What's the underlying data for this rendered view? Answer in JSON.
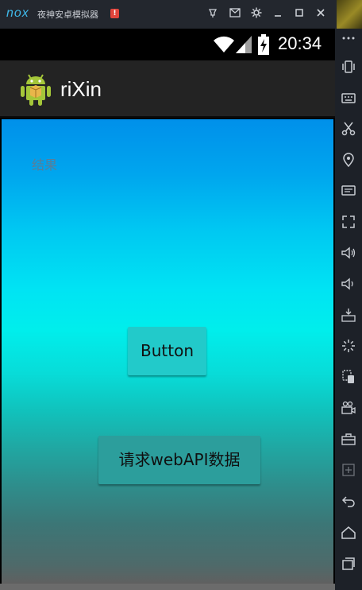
{
  "emulator": {
    "logo": "nox",
    "title": "夜神安卓模拟器",
    "warning_badge": "!",
    "titlebar_buttons": [
      "pin-icon",
      "mail-icon",
      "settings-icon",
      "minimize-icon",
      "maximize-icon",
      "close-icon"
    ],
    "toolbar_icons": [
      "more-icon",
      "shake-icon",
      "keyboard-icon",
      "scissors-icon",
      "location-icon",
      "screen-icon",
      "fullscreen-icon",
      "volume-up-icon",
      "volume-down-icon",
      "apk-icon",
      "loading-icon",
      "multi-instance-icon",
      "video-record-icon",
      "toolbox-icon",
      "add-icon",
      "back-icon",
      "home-icon",
      "recents-icon"
    ]
  },
  "statusbar": {
    "time": "20:34"
  },
  "actionbar": {
    "title": "riXin"
  },
  "content": {
    "result_text": "结果",
    "button1_label": "Button",
    "button2_label": "请求webAPI数据"
  },
  "colors": {
    "nox_blue": "#3fb8e8",
    "actionbar": "#232323",
    "button_teal": "#22caca",
    "background_top": "#0090ea",
    "background_mid": "#00eeec",
    "background_bottom": "#606060"
  }
}
